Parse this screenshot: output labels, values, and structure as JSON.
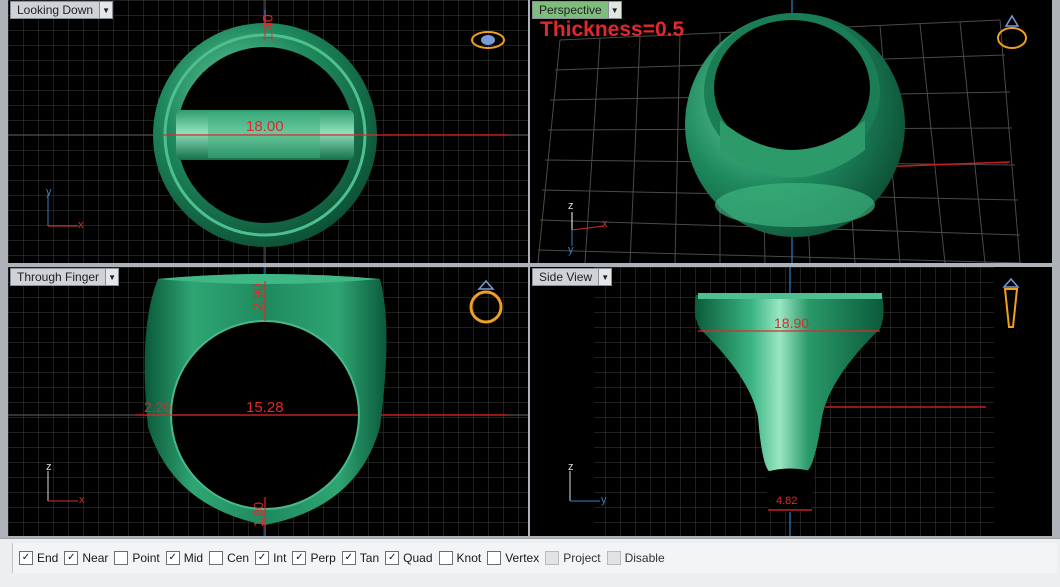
{
  "viewports": {
    "top_left": {
      "title": "Looking Down",
      "dims": [
        "18.00",
        "1.40"
      ],
      "axis_a": "y",
      "axis_b": "x"
    },
    "top_right": {
      "title": "Perspective",
      "annotation": "Thickness=0.5",
      "axis_a": "z",
      "axis_b": "x",
      "axis_c": "y"
    },
    "bottom_left": {
      "title": "Through Finger",
      "dims": [
        "2.90",
        "2.20",
        "15.28",
        "1.80"
      ],
      "axis_a": "z",
      "axis_b": "x"
    },
    "bottom_right": {
      "title": "Side View",
      "dims": [
        "18.90",
        "4.82"
      ],
      "axis_a": "z",
      "axis_b": "y"
    }
  },
  "osnaps": [
    {
      "label": "End",
      "checked": true
    },
    {
      "label": "Near",
      "checked": true
    },
    {
      "label": "Point",
      "checked": false
    },
    {
      "label": "Mid",
      "checked": true
    },
    {
      "label": "Cen",
      "checked": false
    },
    {
      "label": "Int",
      "checked": true
    },
    {
      "label": "Perp",
      "checked": true
    },
    {
      "label": "Tan",
      "checked": true
    },
    {
      "label": "Quad",
      "checked": true
    },
    {
      "label": "Knot",
      "checked": false
    },
    {
      "label": "Vertex",
      "checked": false
    },
    {
      "label": "Project",
      "checked": false,
      "disabled": true
    },
    {
      "label": "Disable",
      "checked": false,
      "disabled": true
    }
  ],
  "colors": {
    "ring": "#1f8a5e",
    "ring_dark": "#0b5a3a",
    "ring_light": "#58c79a",
    "dimension": "#e0282d",
    "grid": "#4a4a4a",
    "active_tab": "#7fbd7c"
  }
}
